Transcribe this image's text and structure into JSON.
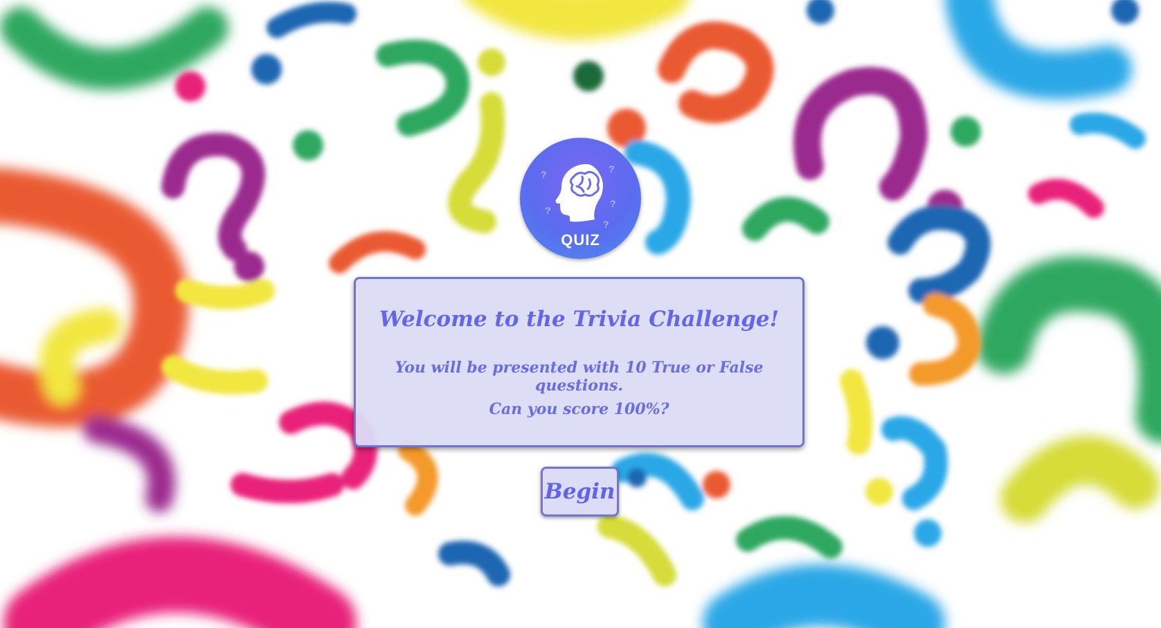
{
  "logo": {
    "icon": "brain-head-icon",
    "label": "QUIZ"
  },
  "intro": {
    "title": "Welcome to the Trivia Challenge!",
    "line1": "You will be presented with 10 True or False questions.",
    "line2": "Can you score 100%?"
  },
  "actions": {
    "begin_label": "Begin"
  },
  "colors": {
    "text_accent": "#6266e8",
    "panel_bg": "#dbdbf6",
    "panel_border": "#6f72d6",
    "logo_gradient_top": "#7a68f0",
    "logo_gradient_bottom": "#4b8bea"
  }
}
